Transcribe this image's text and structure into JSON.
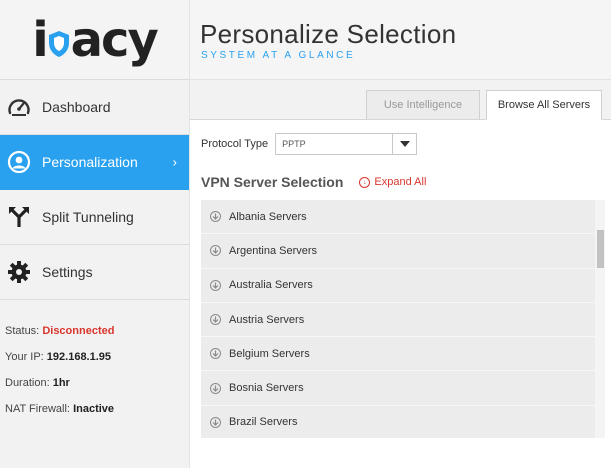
{
  "logo": {
    "text_left": "i",
    "text_right": "acy"
  },
  "nav": [
    {
      "label": "Dashboard",
      "icon": "gauge-icon"
    },
    {
      "label": "Personalization",
      "icon": "user-icon"
    },
    {
      "label": "Split Tunneling",
      "icon": "split-arrow-icon"
    },
    {
      "label": "Settings",
      "icon": "gear-icon"
    }
  ],
  "status": {
    "status_label": "Status:",
    "status_value": "Disconnected",
    "ip_label": "Your IP:",
    "ip_value": "192.168.1.95",
    "duration_label": "Duration:",
    "duration_value": "1hr",
    "nat_label": "NAT Firewall:",
    "nat_value": "Inactive"
  },
  "header": {
    "title": "Personalize Selection",
    "subtitle": "SYSTEM AT A GLANCE"
  },
  "tabs": [
    {
      "label": "Use Intelligence"
    },
    {
      "label": "Browse All Servers"
    }
  ],
  "protocol": {
    "label": "Protocol Type",
    "value": "PPTP"
  },
  "section": {
    "title": "VPN Server Selection",
    "expand_all": "Expand All"
  },
  "servers": [
    "Albania Servers",
    "Argentina Servers",
    "Australia Servers",
    "Austria Servers",
    "Belgium Servers",
    "Bosnia Servers",
    "Brazil Servers"
  ],
  "colors": {
    "accent": "#2aa1ef",
    "danger": "#d9362d"
  }
}
